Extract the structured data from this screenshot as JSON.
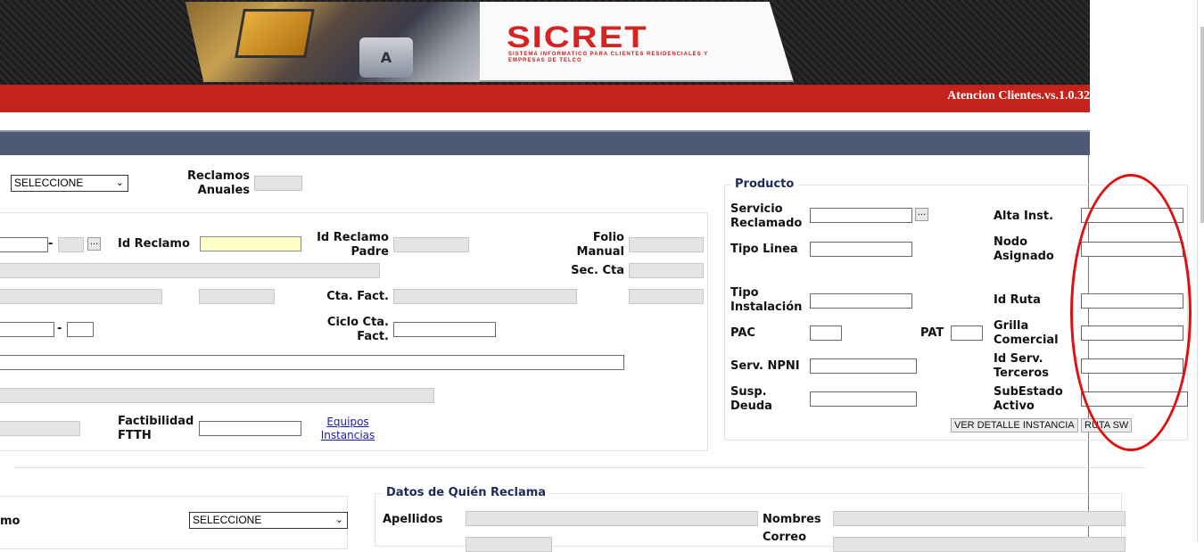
{
  "header": {
    "logo_title": "SICRET",
    "logo_subtitle": "SISTEMA INFORMATICO PARA CLIENTES RESIDENCIALES Y EMPRESAS DE TELCO",
    "photo_key_letter": "A",
    "version": "Atencion Clientes.vs.1.0.32"
  },
  "top": {
    "tipo_select": "SELECCIONE",
    "reclamos_anuales_label": "Reclamos Anuales",
    "reclamos_anuales_value": ""
  },
  "reclamo": {
    "dash": "-",
    "dots": "...",
    "id_reclamo_label": "Id Reclamo",
    "id_reclamo_value": "",
    "id_reclamo_padre_label": "Id Reclamo Padre",
    "folio_manual_label": "Folio Manual",
    "sec_cta_label": "Sec. Cta",
    "cta_fact_label": "Cta. Fact.",
    "ciclo_cta_fact_label": "Ciclo Cta. Fact.",
    "factibilidad_ftth_label": "Factibilidad FTTH",
    "equipos_instancias_link": "Equipos Instancias"
  },
  "producto": {
    "legend": "Producto",
    "servicio_reclamado_label": "Servicio Reclamado",
    "tipo_linea_label": "Tipo Linea",
    "tipo_instalacion_label": "Tipo Instalación",
    "pac_label": "PAC",
    "pat_label": "PAT",
    "serv_npni_label": "Serv. NPNI",
    "susp_deuda_label": "Susp. Deuda",
    "alta_inst_label": "Alta Inst.",
    "nodo_asignado_label": "Nodo Asignado",
    "id_ruta_label": "Id Ruta",
    "grilla_comercial_label": "Grilla Comercial",
    "id_serv_terceros_label": "Id Serv. Terceros",
    "subestado_activo_label": "SubEstado Activo",
    "ver_detalle_button": "VER DETALLE INSTANCIA",
    "ruta_sw_button": "RUTA SW"
  },
  "bottom": {
    "left_label_partial": "mo",
    "left_select": "SELECCIONE",
    "quien_reclama_legend": "Datos de Quién Reclama",
    "apellidos_label": "Apellidos",
    "nombres_label": "Nombres",
    "correo_label": "Correo"
  },
  "colors": {
    "header_red": "#c4221b",
    "slate_bar": "#4e5a74",
    "readonly_bg": "#e4e4e4",
    "highlight_yellow": "#ffffc8",
    "annotation_red": "#e01010",
    "legend_navy": "#1c2a5a"
  }
}
